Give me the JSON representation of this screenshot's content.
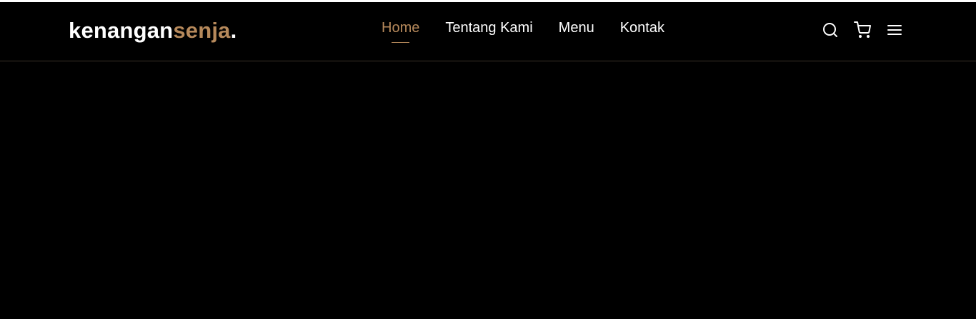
{
  "brand": {
    "name_main": "kenangan",
    "name_accent": "senja",
    "name_suffix": "."
  },
  "nav": {
    "links": [
      {
        "label": "Home",
        "active": true
      },
      {
        "label": "Tentang Kami",
        "active": false
      },
      {
        "label": "Menu",
        "active": false
      },
      {
        "label": "Kontak",
        "active": false
      }
    ],
    "icons": [
      "search-icon",
      "shopping-cart-icon",
      "hamburger-menu-icon"
    ]
  },
  "colors": {
    "background": "#000000",
    "accent": "#b6895b",
    "text": "#ffffff"
  }
}
